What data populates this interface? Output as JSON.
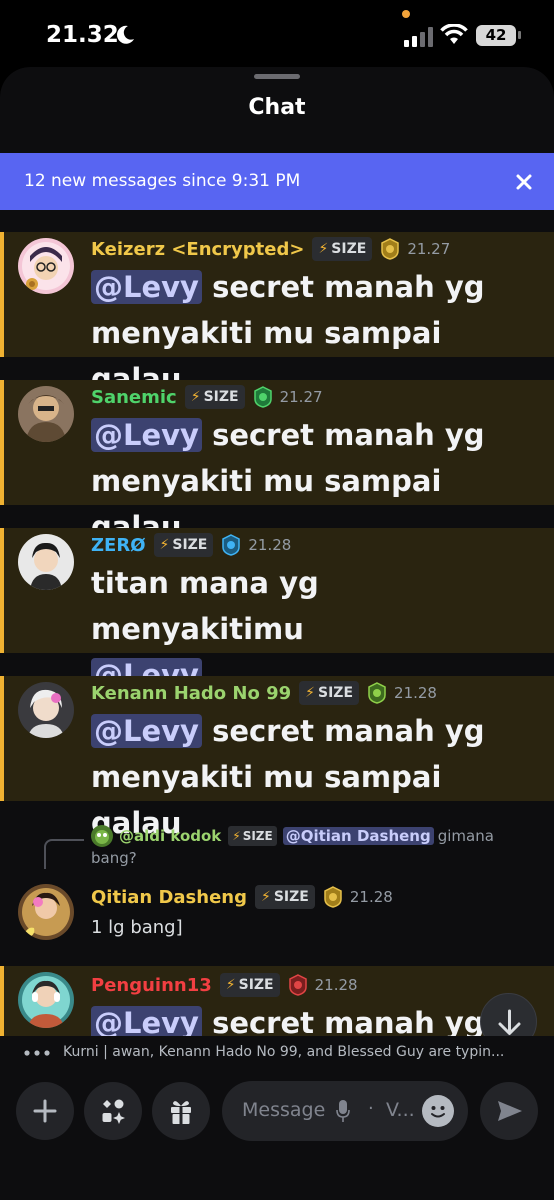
{
  "status": {
    "time": "21.32",
    "battery": "42"
  },
  "header": {
    "title": "Chat"
  },
  "banner": {
    "text": "12 new messages since 9:31 PM"
  },
  "size_tag": "SIZE",
  "messages": [
    {
      "user": "Keizerz <Encrypted>",
      "name_color": "#f0c84a",
      "time": "21.27",
      "mention": "@Levy",
      "text_after": " secret manah yg",
      "line2": "menyakiti mu sampai galau"
    },
    {
      "user": "Sanemic",
      "name_color": "#4fd36b",
      "time": "21.27",
      "mention": "@Levy",
      "text_after": " secret manah yg",
      "line2": "menyakiti mu sampai galau"
    },
    {
      "user": "ZERØ",
      "name_color": "#3fb3f5",
      "time": "21.28",
      "text_before": "titan mana yg menyakitimu",
      "mention": "@Levy"
    },
    {
      "user": "Kenann Hado No 99",
      "name_color": "#9bd36e",
      "time": "21.28",
      "mention": "@Levy",
      "text_after": " secret manah yg",
      "line2": "menyakiti mu sampai galau"
    },
    {
      "user": "Qitian Dasheng",
      "name_color": "#f0c84a",
      "time": "21.28",
      "text": "1 lg bang]"
    },
    {
      "user": "Penguinn13",
      "name_color": "#f23f42",
      "time": "21.28",
      "mention": "@Levy",
      "text_after": " secret manah yg"
    }
  ],
  "reply": {
    "user": "@aldi kodok",
    "mention": "@Qitian Dasheng",
    "text": "gimana",
    "text2": "bang?"
  },
  "typing": {
    "text": "Kurni | awan, Kenann Hado No 99, and Blessed Guy are typin..."
  },
  "composer": {
    "placeholder": "Message",
    "suffix": "V..."
  },
  "colors": {
    "accent": "#5865f2",
    "mention_bg": "#2a2410",
    "mention_bar": "#f0b232"
  }
}
